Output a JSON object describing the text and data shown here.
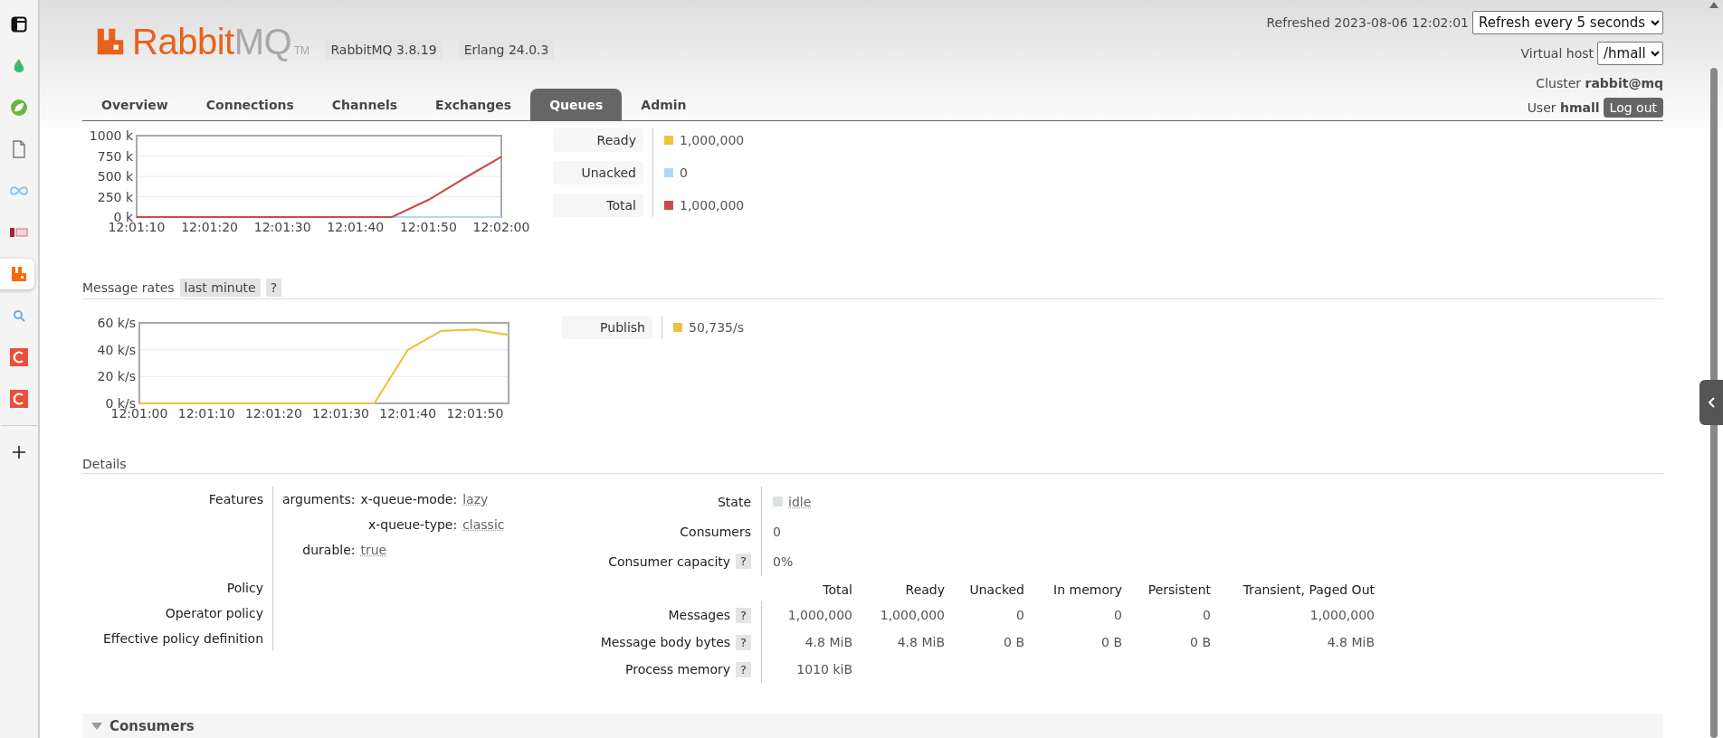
{
  "browser_sidebar": {
    "items": [
      {
        "selected": false
      },
      {
        "selected": false
      },
      {
        "selected": false
      },
      {
        "selected": false
      },
      {
        "selected": false
      },
      {
        "selected": false
      },
      {
        "selected": true
      },
      {
        "selected": false
      },
      {
        "selected": false
      },
      {
        "selected": false
      },
      {
        "selected": false
      }
    ]
  },
  "header": {
    "logo": {
      "brand": "Rabbit",
      "product": "MQ",
      "mark": "TM"
    },
    "versions": [
      "RabbitMQ 3.8.19",
      "Erlang 24.0.3"
    ],
    "refreshed": "Refreshed 2023-08-06 12:02:01",
    "refresh_select": "Refresh every 5 seconds",
    "vhost_label": "Virtual host",
    "vhost_select": "/hmall",
    "cluster": "Cluster **rabbit@mq**",
    "user": "User **hmall**",
    "logout": "Log out"
  },
  "tabs": [
    {
      "label": "Overview",
      "selected": false
    },
    {
      "label": "Connections",
      "selected": false
    },
    {
      "label": "Channels",
      "selected": false
    },
    {
      "label": "Exchanges",
      "selected": false
    },
    {
      "label": "Queues",
      "selected": true
    },
    {
      "label": "Admin",
      "selected": false
    }
  ],
  "queued_messages": {
    "chart_data": {
      "type": "line",
      "grid": true,
      "categories": [
        "12:01:10",
        null,
        "12:01:20",
        null,
        "12:01:30",
        null,
        "12:01:40",
        null,
        "12:01:50",
        null,
        "12:02:00"
      ],
      "ylim": [
        0,
        1000000
      ],
      "yticks": [
        {
          "value": 0,
          "label": "0 k"
        },
        {
          "value": 250000,
          "label": "250 k"
        },
        {
          "value": 500000,
          "label": "500 k"
        },
        {
          "value": 750000,
          "label": "750 k"
        },
        {
          "value": 1000000,
          "label": "1000 k"
        }
      ],
      "series": [
        {
          "name": "Ready",
          "color": "#edc240",
          "values": [
            null,
            null,
            null,
            null,
            null,
            null,
            null,
            null,
            null,
            null,
            null
          ]
        },
        {
          "name": "Unacked",
          "color": "#afd8f8",
          "values": [
            null,
            null,
            null,
            null,
            null,
            null,
            null,
            0,
            0,
            0,
            0
          ]
        },
        {
          "name": "Total",
          "color": "#cb4b4b",
          "values": [
            0,
            0,
            0,
            0,
            0,
            0,
            0,
            0,
            210000,
            480000,
            740000
          ]
        }
      ]
    },
    "legend": [
      {
        "value": "1,000,000"
      },
      {
        "value": "0"
      },
      {
        "value": "1,000,000"
      }
    ]
  },
  "message_rates": {
    "title": "Message rates",
    "range": "last minute",
    "help": "?",
    "chart_data": {
      "type": "line",
      "grid": true,
      "categories": [
        "12:01:00",
        null,
        "12:01:10",
        null,
        "12:01:20",
        null,
        "12:01:30",
        null,
        "12:01:40",
        null,
        "12:01:50",
        null
      ],
      "ylim": [
        0,
        60000
      ],
      "yticks": [
        {
          "value": 0,
          "label": "0 k/s"
        },
        {
          "value": 20000,
          "label": "20 k/s"
        },
        {
          "value": 40000,
          "label": "40 k/s"
        },
        {
          "value": 60000,
          "label": "60 k/s"
        }
      ],
      "series": [
        {
          "name": "Publish",
          "color": "#edc240",
          "values": [
            0,
            0,
            0,
            0,
            0,
            0,
            0,
            0,
            40000,
            54000,
            55000,
            51000
          ]
        }
      ]
    },
    "legend": [
      {
        "value": "50,735/s"
      }
    ]
  },
  "details": {
    "title": "Details",
    "features": {
      "label": "Features",
      "arguments_label": "arguments:",
      "arguments": [
        {
          "key": "x-queue-mode:",
          "value": "lazy"
        },
        {
          "key": "x-queue-type:",
          "value": "classic"
        }
      ],
      "durable_label": "durable:",
      "durable": "true"
    },
    "policies": [
      {
        "label": "Policy"
      },
      {
        "label": "Operator policy"
      },
      {
        "label": "Effective policy definition"
      }
    ],
    "state": {
      "label": "State",
      "value": "idle"
    },
    "facts": [
      {
        "label": "Consumers",
        "value": "0"
      },
      {
        "label": "Consumer capacity",
        "help": "?",
        "value": "0%"
      }
    ],
    "stats": {
      "columns": [
        "Total",
        "Ready",
        "Unacked",
        "In memory",
        "Persistent",
        "Transient, Paged Out"
      ],
      "rows": [
        {
          "label": "Messages",
          "help": "?",
          "cells": [
            "1,000,000",
            "1,000,000",
            "0",
            "0",
            "0",
            "1,000,000"
          ]
        },
        {
          "label": "Message body bytes",
          "help": "?",
          "cells": [
            "4.8 MiB",
            "4.8 MiB",
            "0 B",
            "0 B",
            "0 B",
            "4.8 MiB"
          ]
        },
        {
          "label": "Process memory",
          "help": "?",
          "cells": [
            "1010 kiB"
          ]
        }
      ]
    }
  },
  "consumers_section": {
    "title": "Consumers",
    "expanded": true
  }
}
